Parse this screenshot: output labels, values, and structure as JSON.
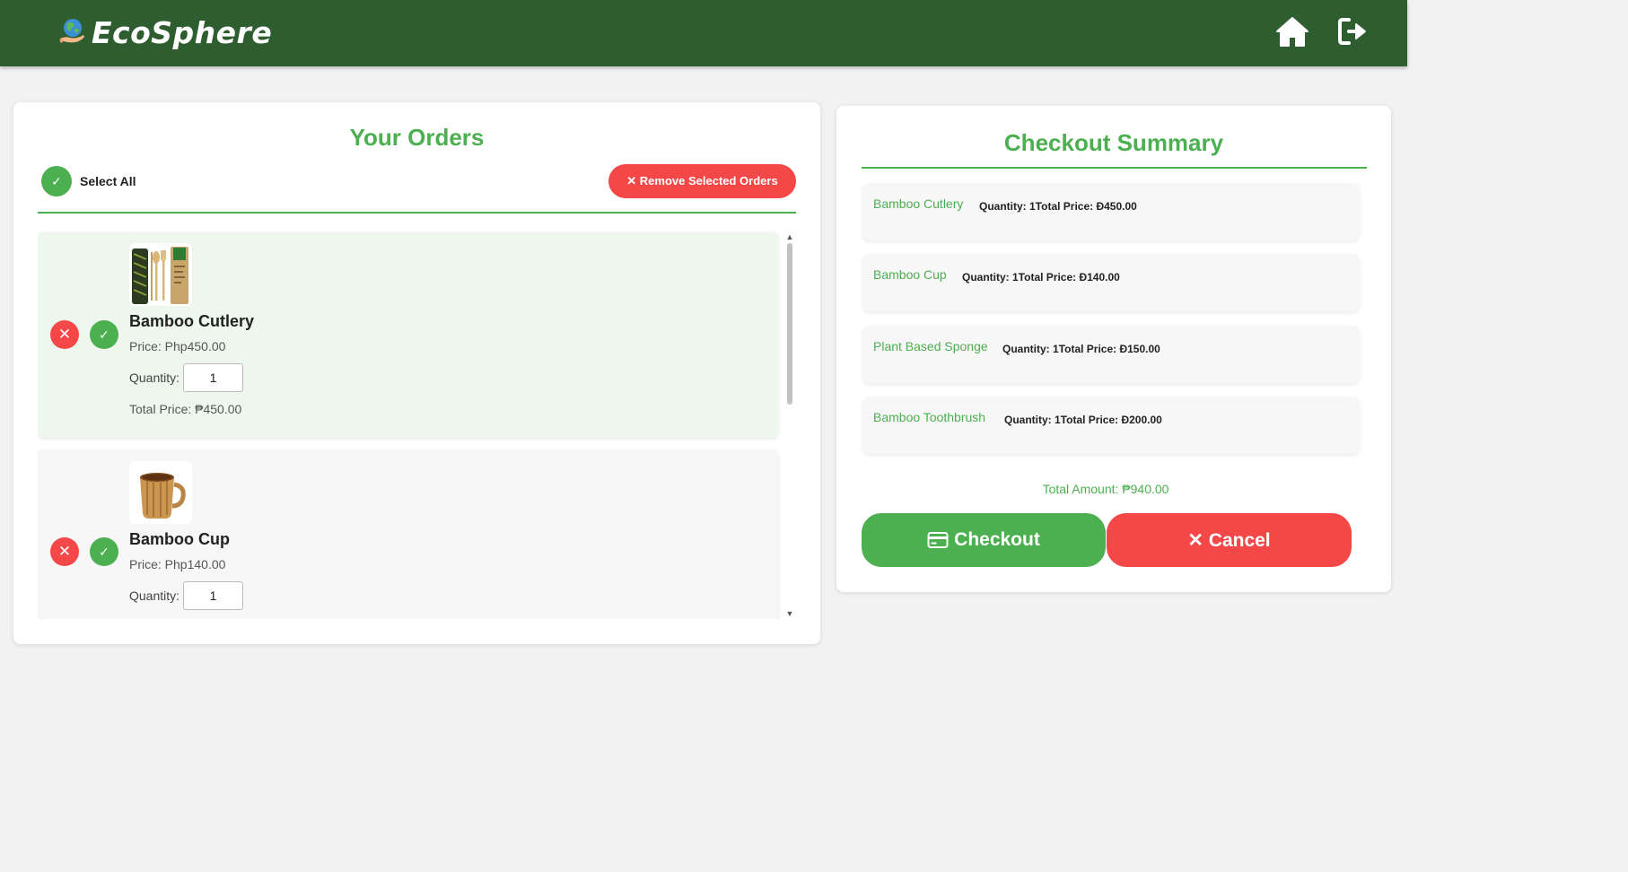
{
  "header": {
    "brand": "EcoSphere",
    "home_icon": "home-icon",
    "logout_icon": "logout-icon"
  },
  "orders": {
    "title": "Your Orders",
    "select_all_label": "Select All",
    "remove_selected_label": "✕ Remove Selected Orders",
    "items": [
      {
        "name": "Bamboo Cutlery",
        "price": "Price: Php450.00",
        "quantity_label": "Quantity:",
        "quantity": "1",
        "total": "Total Price: ₱450.00",
        "selected": true
      },
      {
        "name": "Bamboo Cup",
        "price": "Price: Php140.00",
        "quantity_label": "Quantity:",
        "quantity": "1",
        "total": "",
        "selected": false
      }
    ]
  },
  "summary": {
    "title": "Checkout Summary",
    "items": [
      {
        "name": "Bamboo Cutlery",
        "detail": "Quantity: 1Total Price: Đ450.00"
      },
      {
        "name": "Bamboo Cup",
        "detail": "Quantity: 1Total Price: Đ140.00"
      },
      {
        "name": "Plant Based Sponge",
        "detail": "Quantity: 1Total Price: Đ150.00"
      },
      {
        "name": "Bamboo Toothbrush",
        "detail": "Quantity: 1Total Price: Đ200.00"
      }
    ],
    "total_amount": "Total Amount: ₱940.00",
    "checkout_label": "Checkout",
    "cancel_label": "✕ Cancel"
  },
  "colors": {
    "header_bg": "#2e5e30",
    "accent_green": "#4caf50",
    "danger_red": "#f44848",
    "selected_card_bg": "#edf7ee"
  }
}
